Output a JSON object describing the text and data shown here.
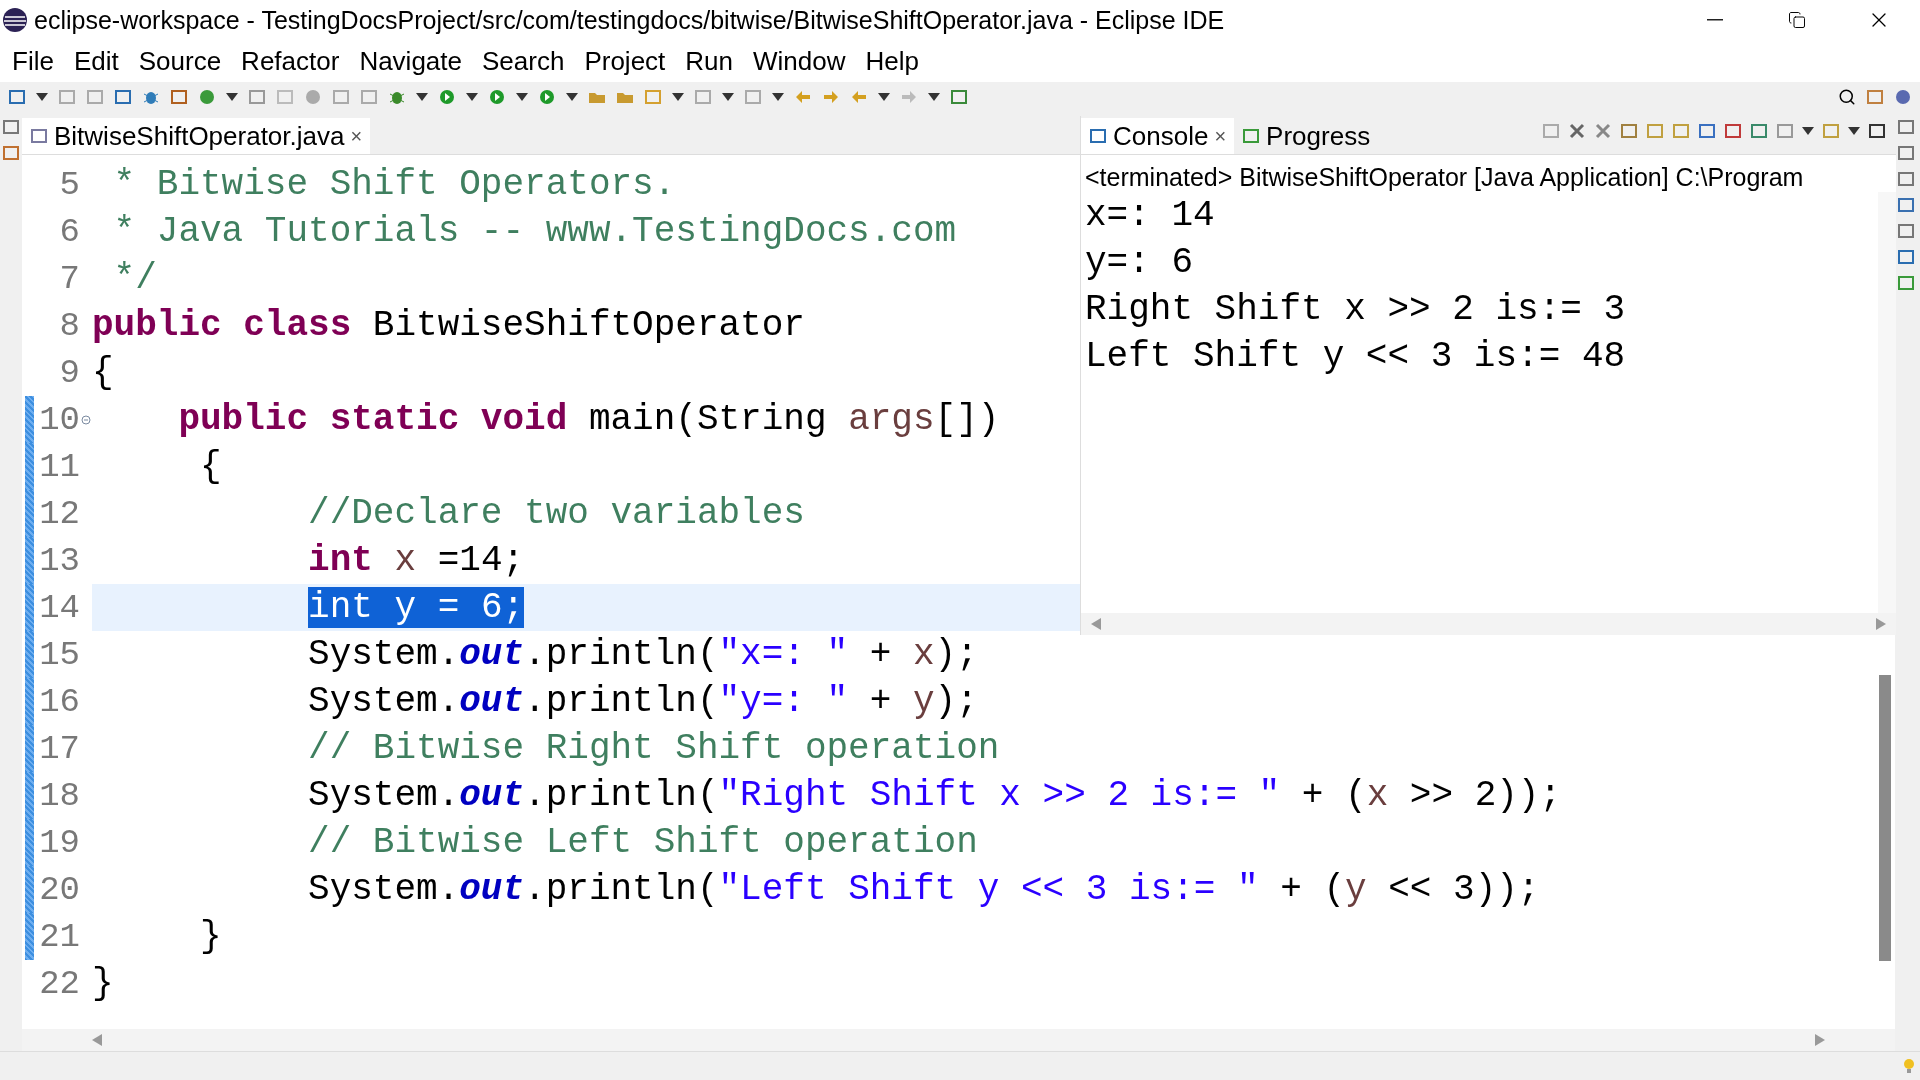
{
  "window": {
    "title": "eclipse-workspace - TestingDocsProject/src/com/testingdocs/bitwise/BitwiseShiftOperator.java - Eclipse IDE"
  },
  "menu": [
    "File",
    "Edit",
    "Source",
    "Refactor",
    "Navigate",
    "Search",
    "Project",
    "Run",
    "Window",
    "Help"
  ],
  "editor": {
    "tab": {
      "label": "BitwiseShiftOperator.java",
      "close": "×"
    },
    "lines": [
      {
        "number": "5",
        "changed": false,
        "fold": false,
        "current": false,
        "tokens": [
          {
            "kind": "comment",
            "text": " * Bitwise Shift Operators."
          }
        ]
      },
      {
        "number": "6",
        "changed": false,
        "fold": false,
        "current": false,
        "tokens": [
          {
            "kind": "comment",
            "text": " * Java Tutorials -- www.TestingDocs.com"
          }
        ]
      },
      {
        "number": "7",
        "changed": false,
        "fold": false,
        "current": false,
        "tokens": [
          {
            "kind": "comment",
            "text": " */"
          }
        ]
      },
      {
        "number": "8",
        "changed": false,
        "fold": false,
        "current": false,
        "tokens": [
          {
            "kind": "keyword",
            "text": "public class"
          },
          {
            "kind": "plain",
            "text": " BitwiseShiftOperator"
          }
        ]
      },
      {
        "number": "9",
        "changed": false,
        "fold": false,
        "current": false,
        "tokens": [
          {
            "kind": "plain",
            "text": "{"
          }
        ]
      },
      {
        "number": "10",
        "changed": true,
        "fold": true,
        "current": false,
        "tokens": [
          {
            "kind": "keyword",
            "text": "    public static void"
          },
          {
            "kind": "plain",
            "text": " main(String "
          },
          {
            "kind": "local",
            "text": "args"
          },
          {
            "kind": "plain",
            "text": "[])"
          }
        ]
      },
      {
        "number": "11",
        "changed": true,
        "fold": false,
        "current": false,
        "tokens": [
          {
            "kind": "plain",
            "text": "     {"
          }
        ]
      },
      {
        "number": "12",
        "changed": true,
        "fold": false,
        "current": false,
        "tokens": [
          {
            "kind": "comment",
            "text": "          //Declare two variables"
          }
        ]
      },
      {
        "number": "13",
        "changed": true,
        "fold": false,
        "current": false,
        "tokens": [
          {
            "kind": "keyword",
            "text": "          int"
          },
          {
            "kind": "local",
            "text": " x"
          },
          {
            "kind": "plain",
            "text": " =14;"
          }
        ]
      },
      {
        "number": "14",
        "changed": true,
        "fold": false,
        "current": true,
        "tokens": [
          {
            "kind": "selection",
            "text": "          int y = 6;"
          }
        ]
      },
      {
        "number": "15",
        "changed": true,
        "fold": false,
        "current": false,
        "tokens": [
          {
            "kind": "plain",
            "text": "          System."
          },
          {
            "kind": "field",
            "text": "out"
          },
          {
            "kind": "plain",
            "text": ".println("
          },
          {
            "kind": "string",
            "text": "\"x=: \""
          },
          {
            "kind": "plain",
            "text": " + "
          },
          {
            "kind": "local",
            "text": "x"
          },
          {
            "kind": "plain",
            "text": ");"
          }
        ]
      },
      {
        "number": "16",
        "changed": true,
        "fold": false,
        "current": false,
        "tokens": [
          {
            "kind": "plain",
            "text": "          System."
          },
          {
            "kind": "field",
            "text": "out"
          },
          {
            "kind": "plain",
            "text": ".println("
          },
          {
            "kind": "string",
            "text": "\"y=: \""
          },
          {
            "kind": "plain",
            "text": " + "
          },
          {
            "kind": "local",
            "text": "y"
          },
          {
            "kind": "plain",
            "text": ");"
          }
        ]
      },
      {
        "number": "17",
        "changed": true,
        "fold": false,
        "current": false,
        "tokens": [
          {
            "kind": "comment",
            "text": "          // Bitwise Right Shift operation"
          }
        ]
      },
      {
        "number": "18",
        "changed": true,
        "fold": false,
        "current": false,
        "tokens": [
          {
            "kind": "plain",
            "text": "          System."
          },
          {
            "kind": "field",
            "text": "out"
          },
          {
            "kind": "plain",
            "text": ".println("
          },
          {
            "kind": "string",
            "text": "\"Right Shift x >> 2 is:= \""
          },
          {
            "kind": "plain",
            "text": " + ("
          },
          {
            "kind": "local",
            "text": "x"
          },
          {
            "kind": "plain",
            "text": " >> 2));"
          }
        ]
      },
      {
        "number": "19",
        "changed": true,
        "fold": false,
        "current": false,
        "tokens": [
          {
            "kind": "comment",
            "text": "          // Bitwise Left Shift operation"
          }
        ]
      },
      {
        "number": "20",
        "changed": true,
        "fold": false,
        "current": false,
        "tokens": [
          {
            "kind": "plain",
            "text": "          System."
          },
          {
            "kind": "field",
            "text": "out"
          },
          {
            "kind": "plain",
            "text": ".println("
          },
          {
            "kind": "string",
            "text": "\"Left Shift y << 3 is:= \""
          },
          {
            "kind": "plain",
            "text": " + ("
          },
          {
            "kind": "local",
            "text": "y"
          },
          {
            "kind": "plain",
            "text": " << 3));"
          }
        ]
      },
      {
        "number": "21",
        "changed": true,
        "fold": false,
        "current": false,
        "tokens": [
          {
            "kind": "plain",
            "text": "     }"
          }
        ]
      },
      {
        "number": "22",
        "changed": false,
        "fold": false,
        "current": false,
        "tokens": [
          {
            "kind": "plain",
            "text": "}"
          }
        ]
      }
    ]
  },
  "console": {
    "tabs": [
      {
        "label": "Console",
        "selected": true,
        "close": "×"
      },
      {
        "label": "Progress",
        "selected": false
      }
    ],
    "status": "<terminated> BitwiseShiftOperator [Java Application] C:\\Program",
    "output": [
      "x=: 14",
      "y=: 6",
      "Right Shift x >> 2 is:= 3",
      "Left Shift y << 3 is:= 48"
    ]
  }
}
